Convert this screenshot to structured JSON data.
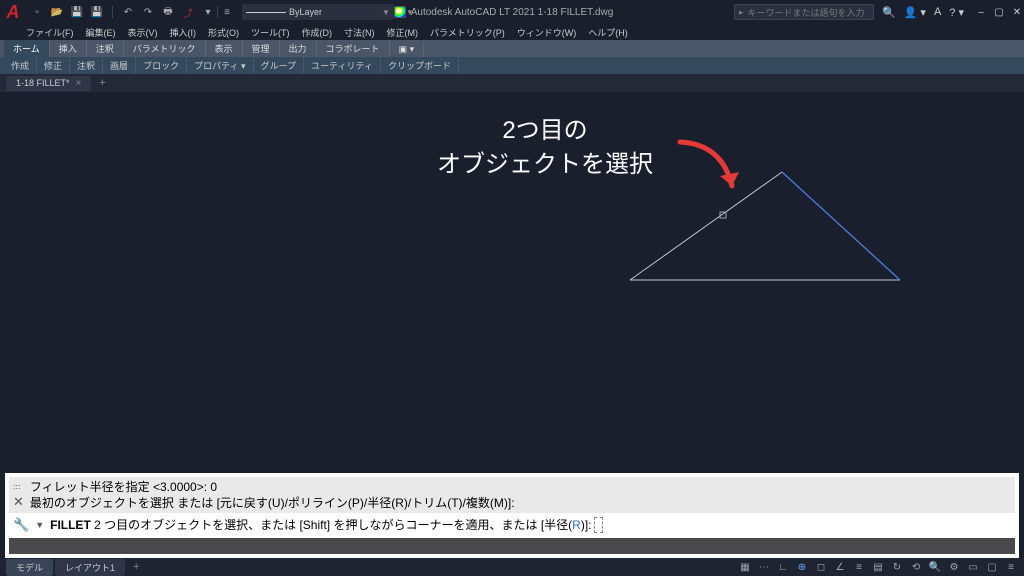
{
  "titlebar": {
    "title_text": "Autodesk AutoCAD LT 2021   1-18 FILLET.dwg",
    "search_placeholder": "キーワードまたは語句を入力",
    "layer_label": "ByLayer"
  },
  "menubar": [
    "ファイル(F)",
    "編集(E)",
    "表示(V)",
    "挿入(I)",
    "形式(O)",
    "ツール(T)",
    "作成(D)",
    "寸法(N)",
    "修正(M)",
    "パラメトリック(P)",
    "ウィンドウ(W)",
    "ヘルプ(H)"
  ],
  "ribbon_tabs": [
    "ホーム",
    "挿入",
    "注釈",
    "パラメトリック",
    "表示",
    "管理",
    "出力",
    "コラボレート"
  ],
  "ribbon_panels": [
    "作成",
    "修正",
    "注釈",
    "画層",
    "ブロック",
    "プロパティ ▾",
    "グループ",
    "ユーティリティ",
    "クリップボード"
  ],
  "file_tab": {
    "name": "1-18 FILLET*"
  },
  "annotation": {
    "line1": "2つ目の",
    "line2": "オブジェクトを選択"
  },
  "command": {
    "history1": "フィレット半径を指定 <3.0000>: 0",
    "history2": "最初のオブジェクトを選択 または [元に戻す(U)/ポリライン(P)/半径(R)/トリム(T)/複数(M)]:",
    "kw": "FILLET",
    "prompt_main": " 2 つ目のオブジェクトを選択、または [Shift] を押しながらコーナーを適用、または ",
    "opt_open": "[",
    "opt_label": "半径(",
    "opt_r": "R",
    "opt_close": ")]",
    "colon": ":"
  },
  "status_tabs": {
    "model": "モデル",
    "layout1": "レイアウト1"
  }
}
